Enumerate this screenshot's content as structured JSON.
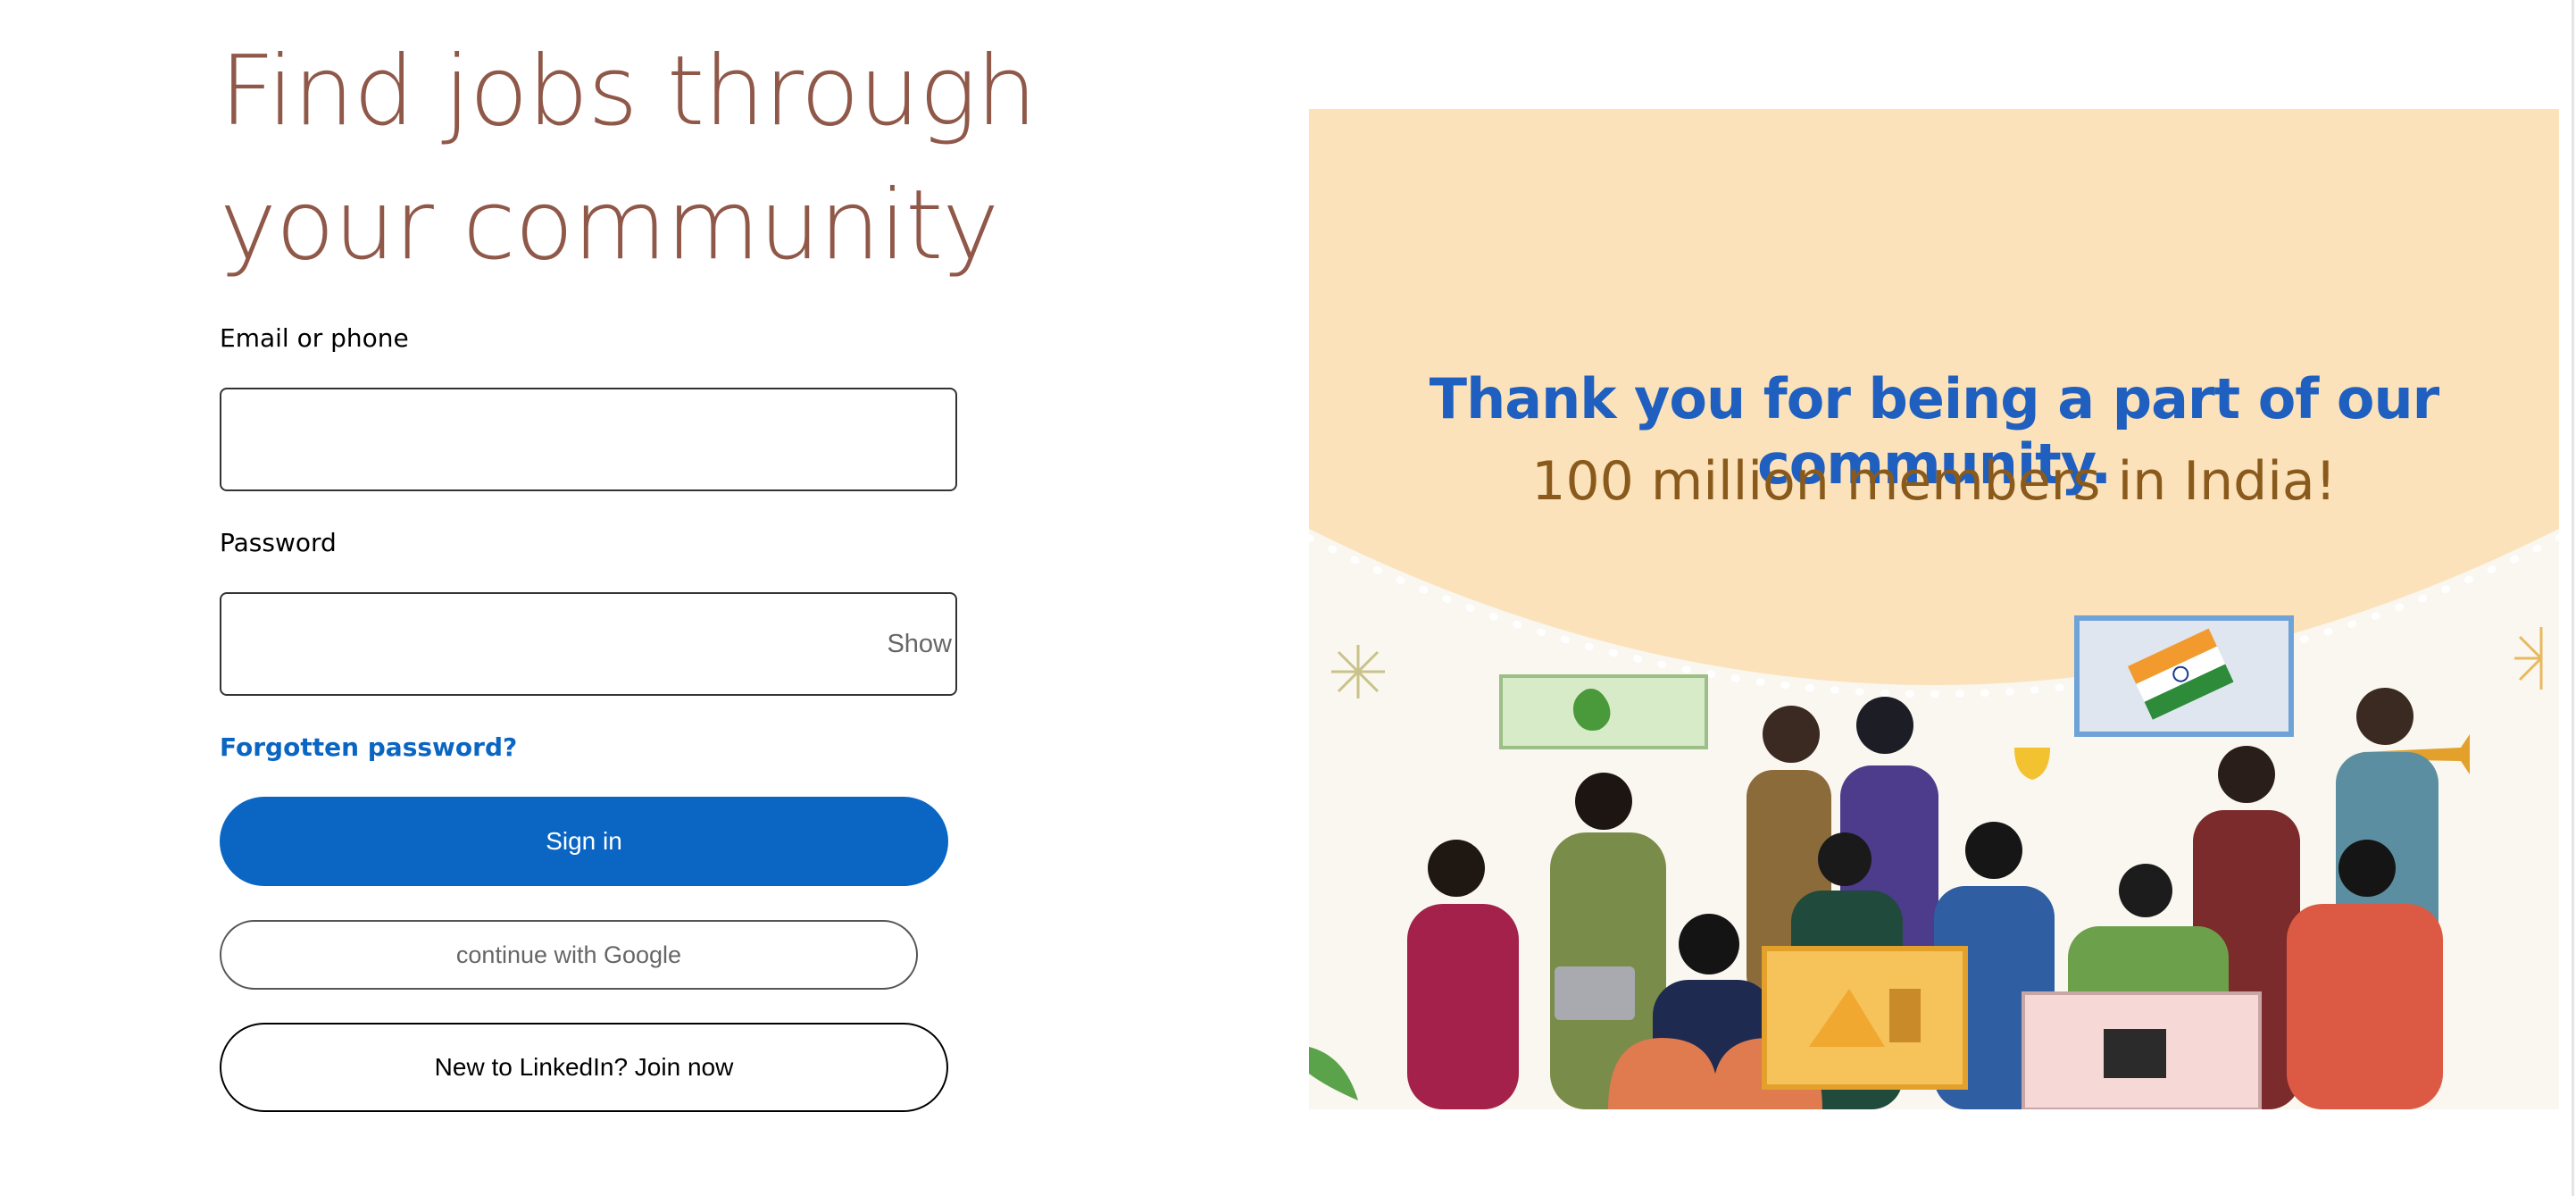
{
  "hero": {
    "title": "Find jobs through your community"
  },
  "form": {
    "email_label": "Email or phone",
    "email_value": "",
    "email_placeholder": "",
    "password_label": "Password",
    "password_value": "",
    "password_placeholder": "",
    "show_label": "Show",
    "forgot_label": "Forgotten password?",
    "signin_label": "Sign in",
    "google_label": "continue with Google",
    "join_label": "New to LinkedIn? Join now"
  },
  "banner": {
    "line1": "Thank you for being a part of our community.",
    "line2": "100 million members in India!"
  },
  "colors": {
    "title": "#8f5849",
    "primary": "#0a66c2",
    "banner_bg": "#fbe2bb",
    "banner_heading": "#1f5fbf",
    "banner_subheading": "#8a5a1c"
  },
  "icons": [
    "india-flag-icon",
    "clapping-hands-icon",
    "trophy-icon",
    "trumpet-icon",
    "laptop-icon",
    "samosa-icon",
    "tea-glass-icon",
    "clapperboard-icon",
    "firework-icon",
    "leaf-icon"
  ]
}
